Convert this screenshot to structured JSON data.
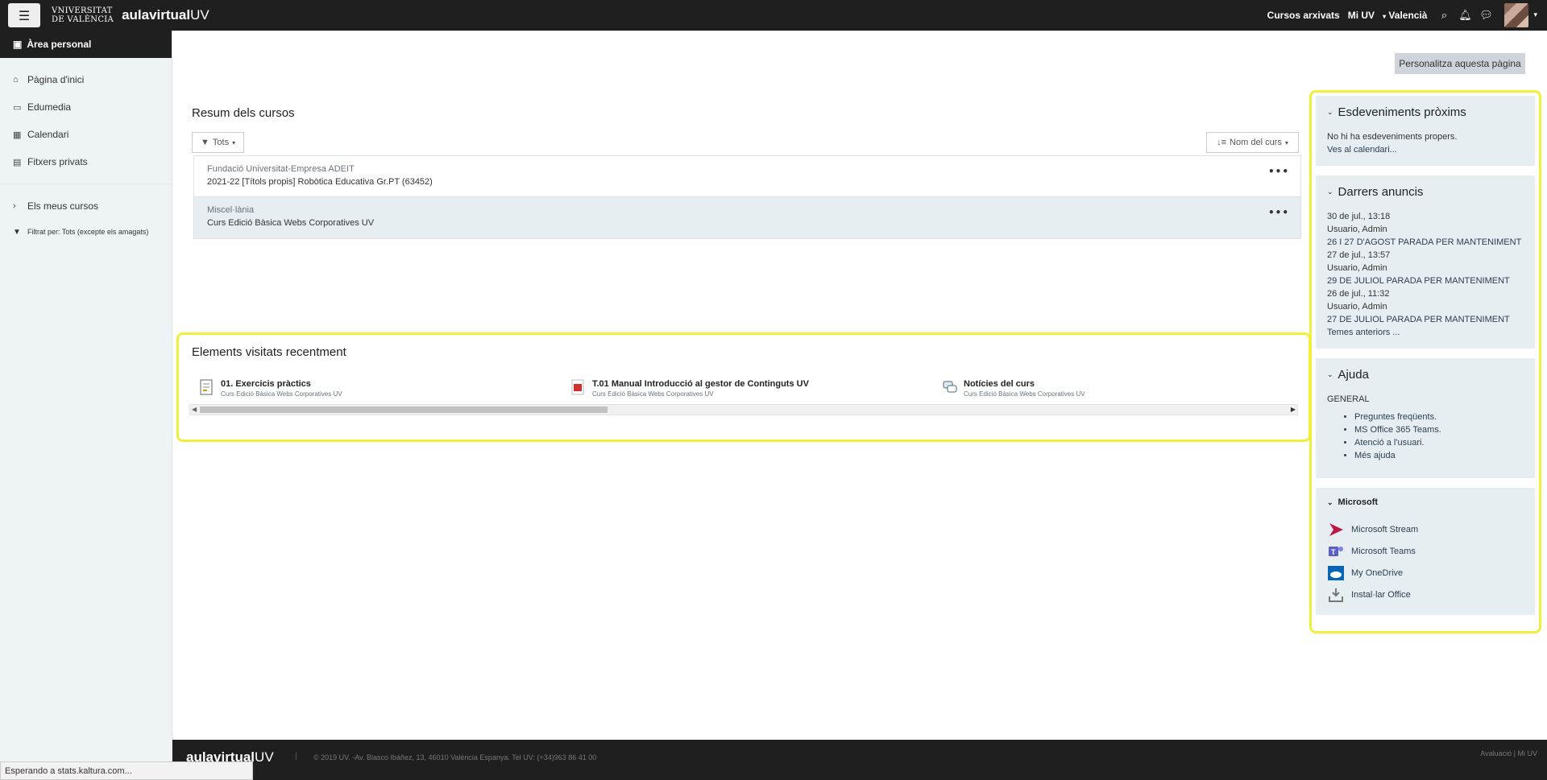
{
  "navbar": {
    "uv_logo_line1": "VNIVERSITAT",
    "uv_logo_line2": "DE VALÈNCIA",
    "aula_logo": "aulavirtual",
    "aula_logo_suffix": "UV",
    "links": [
      "Cursos arxivats",
      "Mi UV"
    ],
    "language": "Valencià"
  },
  "sidebar": {
    "header": "Àrea personal",
    "items": [
      {
        "label": "Pàgina d'inici",
        "icon": "home-icon"
      },
      {
        "label": "Edumedia",
        "icon": "edumedia-icon"
      },
      {
        "label": "Calendari",
        "icon": "calendar-icon"
      },
      {
        "label": "Fitxers privats",
        "icon": "file-icon"
      }
    ],
    "my_courses": "Els meus cursos",
    "filter": "Filtrat per: Tots (excepte els amagats)"
  },
  "main": {
    "personalize_button": "Personalitza aquesta pàgina",
    "course_overview": {
      "title": "Resum dels cursos",
      "filter_label": "Tots",
      "sort_label": "Nom del curs",
      "courses": [
        {
          "category": "Fundació Universitat-Empresa ADEIT",
          "name": "2021-22 [Títols propis] Robòtica Educativa Gr.PT (63452)"
        },
        {
          "category": "Miscel·lània",
          "name": "Curs Edició Bàsica Webs Corporatives UV"
        }
      ]
    },
    "recent": {
      "title": "Elements visitats recentment",
      "items": [
        {
          "name": "01. Exercicis pràctics",
          "course": "Curs Edició Bàsica Webs Corporatives UV",
          "icon": "assignment-icon"
        },
        {
          "name": "T.01 Manual Introducció al gestor de Continguts UV",
          "course": "Curs Edició Bàsica Webs Corporatives UV",
          "icon": "pdf-icon"
        },
        {
          "name": "Notícies del curs",
          "course": "Curs Edició Bàsica Webs Corporatives UV",
          "icon": "forum-icon"
        }
      ]
    }
  },
  "blocks": {
    "events": {
      "title": "Esdeveniments pròxims",
      "empty_text": "No hi ha esdeveniments propers.",
      "calendar_link": "Ves al calendari..."
    },
    "news": {
      "title": "Darrers anuncis",
      "items": [
        {
          "date": "30 de jul., 13:18",
          "author": "Usuario, Admin",
          "subject": "26 I 27 D'AGOST PARADA PER MANTENIMENT"
        },
        {
          "date": "27 de jul., 13:57",
          "author": "Usuario, Admin",
          "subject": "29 DE JULIOL PARADA PER MANTENIMENT"
        },
        {
          "date": "26 de jul., 11:32",
          "author": "Usuario, Admin",
          "subject": "27 DE JULIOL PARADA PER MANTENIMENT"
        }
      ],
      "older": "Temes anteriors ..."
    },
    "help": {
      "title": "Ajuda",
      "section": "GENERAL",
      "links": [
        "Preguntes freqüents.",
        "MS Office 365 Teams.",
        "Atenció a l'usuari.",
        "Més ajuda"
      ]
    },
    "microsoft": {
      "title": "Microsoft",
      "items": [
        {
          "label": "Microsoft Stream",
          "icon": "stream-icon",
          "color": "#bc1948"
        },
        {
          "label": "Microsoft Teams",
          "icon": "teams-icon",
          "color": "#5b5fc7"
        },
        {
          "label": "My OneDrive",
          "icon": "onedrive-icon",
          "color": "#0364b8"
        },
        {
          "label": "Instal·lar Office",
          "icon": "download-icon",
          "color": "#777777"
        }
      ]
    }
  },
  "footer": {
    "logo": "aulavirtual",
    "logo_suffix": "UV",
    "separator": "|",
    "address": "© 2019 UV. -Av. Blasco Ibáñez, 13, 46010 València Espanya. Tel UV: (+34)963 86 41 00",
    "right": "Avaluació | Mi UV"
  },
  "status_bar": "Esperando a stats.kaltura.com..."
}
